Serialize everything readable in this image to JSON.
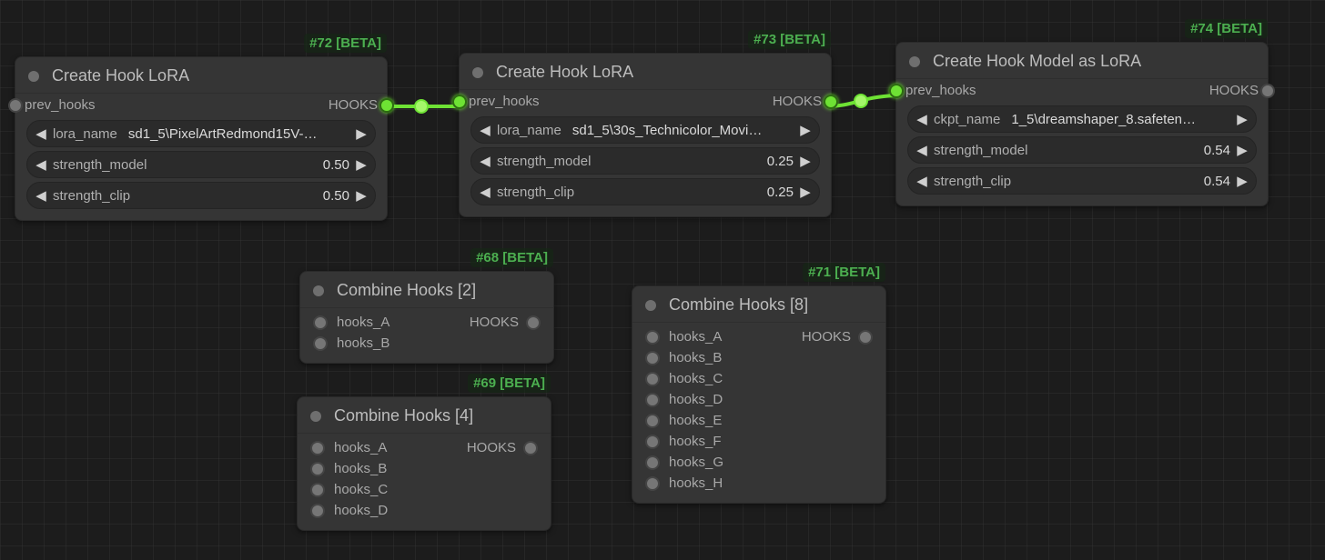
{
  "nodes": {
    "n72": {
      "tag": "#72 [BETA]",
      "title": "Create Hook LoRA",
      "prev_hooks": "prev_hooks",
      "hooks_label": "HOOKS",
      "lora_name_label": "lora_name",
      "lora_name_value": "sd1_5\\PixelArtRedmond15V-…",
      "strength_model_label": "strength_model",
      "strength_model_value": "0.50",
      "strength_clip_label": "strength_clip",
      "strength_clip_value": "0.50"
    },
    "n73": {
      "tag": "#73 [BETA]",
      "title": "Create Hook LoRA",
      "prev_hooks": "prev_hooks",
      "hooks_label": "HOOKS",
      "lora_name_label": "lora_name",
      "lora_name_value": "sd1_5\\30s_Technicolor_Movi…",
      "strength_model_label": "strength_model",
      "strength_model_value": "0.25",
      "strength_clip_label": "strength_clip",
      "strength_clip_value": "0.25"
    },
    "n74": {
      "tag": "#74 [BETA]",
      "title": "Create Hook Model as LoRA",
      "prev_hooks": "prev_hooks",
      "hooks_label": "HOOKS",
      "ckpt_name_label": "ckpt_name",
      "ckpt_name_value": "1_5\\dreamshaper_8.safeten…",
      "strength_model_label": "strength_model",
      "strength_model_value": "0.54",
      "strength_clip_label": "strength_clip",
      "strength_clip_value": "0.54"
    },
    "n68": {
      "tag": "#68 [BETA]",
      "title": "Combine Hooks [2]",
      "hooks_label": "HOOKS",
      "inputs": [
        "hooks_A",
        "hooks_B"
      ]
    },
    "n69": {
      "tag": "#69 [BETA]",
      "title": "Combine Hooks [4]",
      "hooks_label": "HOOKS",
      "inputs": [
        "hooks_A",
        "hooks_B",
        "hooks_C",
        "hooks_D"
      ]
    },
    "n71": {
      "tag": "#71 [BETA]",
      "title": "Combine Hooks [8]",
      "hooks_label": "HOOKS",
      "inputs": [
        "hooks_A",
        "hooks_B",
        "hooks_C",
        "hooks_D",
        "hooks_E",
        "hooks_F",
        "hooks_G",
        "hooks_H"
      ]
    }
  }
}
